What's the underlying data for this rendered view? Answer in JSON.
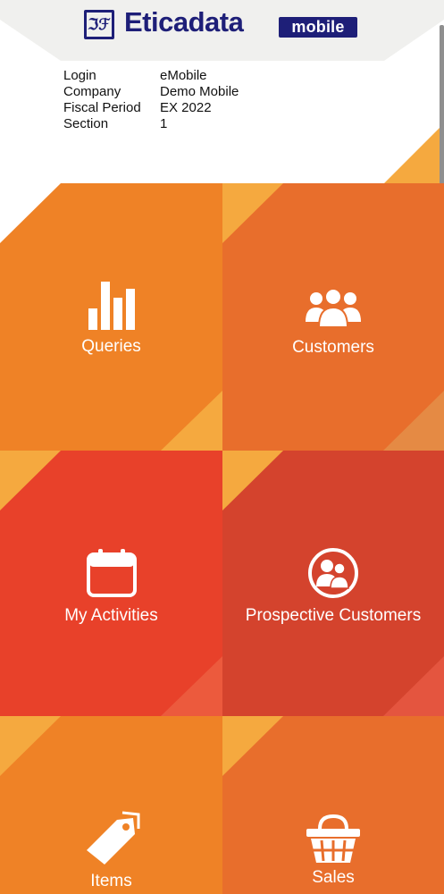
{
  "app": {
    "brand": "Eticadata",
    "badge": "mobile",
    "logo_glyph": "ℑℱ"
  },
  "session": [
    {
      "label": "Login",
      "value": "eMobile"
    },
    {
      "label": "Company",
      "value": "Demo Mobile"
    },
    {
      "label": "Fiscal Period",
      "value": "EX 2022"
    },
    {
      "label": "Section",
      "value": "1"
    }
  ],
  "tiles": [
    {
      "label": "Queries",
      "icon": "bar-chart-icon",
      "color": "#ef8226"
    },
    {
      "label": "Customers",
      "icon": "people-group-icon",
      "color": "#e86e2c"
    },
    {
      "label": "My Activities",
      "icon": "calendar-icon",
      "color": "#e8412a"
    },
    {
      "label": "Prospective Customers",
      "icon": "headset-users-icon",
      "color": "#d4432d"
    },
    {
      "label": "Items",
      "icon": "tag-icon",
      "color": "#ef8226"
    },
    {
      "label": "Sales",
      "icon": "basket-icon",
      "color": "#e86e2c"
    }
  ],
  "colors": {
    "brand_navy": "#1e1f78",
    "accent_yellow": "#f5a93f",
    "header_gray": "#f0f0ee"
  }
}
